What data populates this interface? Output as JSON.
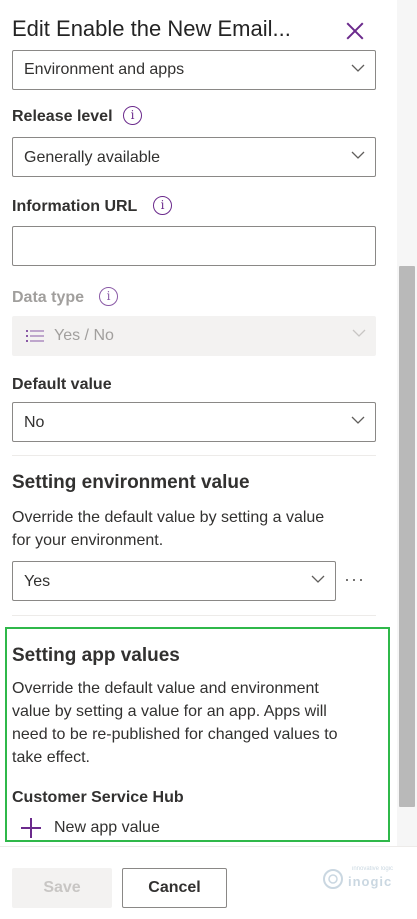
{
  "panel": {
    "title": "Edit Enable the New Email...",
    "close_icon": "close-icon"
  },
  "category": {
    "selected": "Environment and apps"
  },
  "release_level": {
    "label": "Release level",
    "info_icon": "info-icon",
    "selected": "Generally available"
  },
  "information_url": {
    "label": "Information URL",
    "info_icon": "info-icon",
    "value": ""
  },
  "data_type": {
    "label": "Data type",
    "info_icon": "info-icon",
    "selected": "Yes / No",
    "type_icon": "list-icon"
  },
  "default_value": {
    "label": "Default value",
    "selected": "No"
  },
  "environment_value": {
    "title": "Setting environment value",
    "description_line1": "Override the default value by setting a value",
    "description_line2": "for your environment.",
    "selected": "Yes",
    "more_icon": "more-icon",
    "more_label": "···"
  },
  "app_values": {
    "title": "Setting app values",
    "description_lines": [
      "Override the default value and environment",
      "value by setting a value for an app. Apps will",
      "need to be re-published for changed values to",
      "take effect."
    ],
    "app_name": "Customer Service Hub",
    "add_icon": "plus-icon",
    "add_label": "New app value"
  },
  "footer": {
    "save_label": "Save",
    "cancel_label": "Cancel"
  },
  "watermark": {
    "brand": "inogic",
    "tagline": "innovative logic"
  },
  "colors": {
    "accent": "#6b2a8c",
    "highlight_border": "#2fb84a",
    "border": "#8a8886",
    "disabled_bg": "#f3f2f1"
  }
}
